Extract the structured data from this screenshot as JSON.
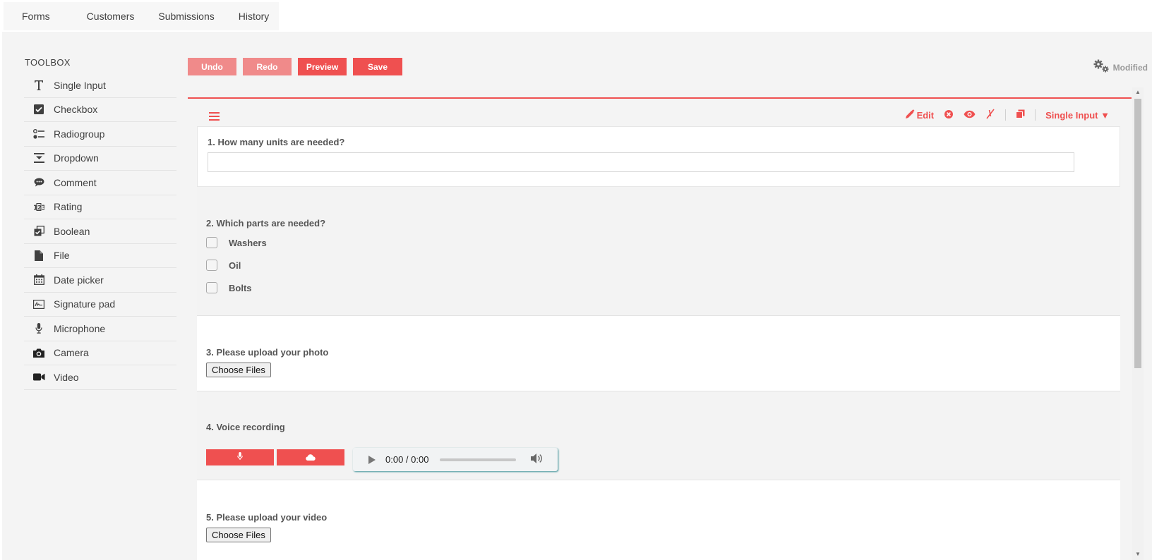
{
  "nav": {
    "items": [
      "Forms",
      "Customers",
      "Submissions",
      "History"
    ]
  },
  "toolbox": {
    "title": "TOOLBOX",
    "items": [
      {
        "label": "Single Input",
        "icon": "text-t-icon"
      },
      {
        "label": "Checkbox",
        "icon": "checkbox-icon"
      },
      {
        "label": "Radiogroup",
        "icon": "radiogroup-icon"
      },
      {
        "label": "Dropdown",
        "icon": "dropdown-icon"
      },
      {
        "label": "Comment",
        "icon": "comment-icon"
      },
      {
        "label": "Rating",
        "icon": "rating-icon"
      },
      {
        "label": "Boolean",
        "icon": "boolean-icon"
      },
      {
        "label": "File",
        "icon": "file-icon"
      },
      {
        "label": "Date picker",
        "icon": "calendar-icon"
      },
      {
        "label": "Signature pad",
        "icon": "signature-icon"
      },
      {
        "label": "Microphone",
        "icon": "microphone-icon"
      },
      {
        "label": "Camera",
        "icon": "camera-icon"
      },
      {
        "label": "Video",
        "icon": "video-icon"
      }
    ]
  },
  "editor": {
    "undo_label": "Undo",
    "redo_label": "Redo",
    "preview_label": "Preview",
    "save_label": "Save",
    "status_label": "Modified"
  },
  "question_toolbar": {
    "edit_label": "Edit",
    "type_label": "Single Input ▼"
  },
  "questions": {
    "q1": {
      "title": "1. How many units are needed?",
      "value": ""
    },
    "q2": {
      "title": "2. Which parts are needed?",
      "choices": [
        "Washers",
        "Oil",
        "Bolts"
      ]
    },
    "q3": {
      "title": "3. Please upload your photo",
      "button": "Choose Files"
    },
    "q4": {
      "title": "4. Voice recording",
      "time": "0:00 / 0:00"
    },
    "q5": {
      "title": "5. Please upload your video",
      "button": "Choose Files"
    }
  },
  "colors": {
    "accent": "#ef5050",
    "accent_faded": "#f08a8a",
    "panel": "#f4f4f4"
  }
}
